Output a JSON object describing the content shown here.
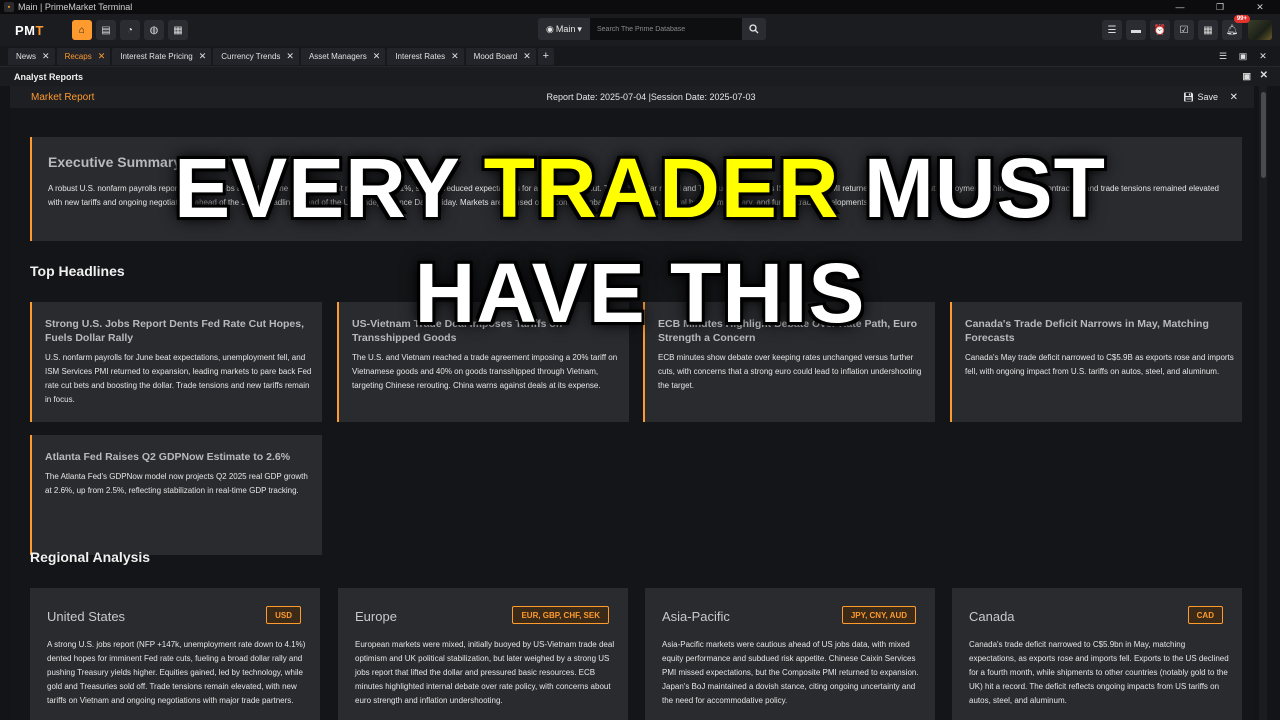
{
  "window": {
    "title": "Main | PrimeMarket Terminal",
    "controls": [
      "—",
      "❐",
      "✕"
    ]
  },
  "nav": {
    "logo_main": "PM",
    "logo_accent": "T",
    "workspace": "Main",
    "search_placeholder": "Search The Prime Database",
    "notification_badge": "99+"
  },
  "tabs": [
    {
      "label": "News",
      "active": false
    },
    {
      "label": "Recaps",
      "active": true
    },
    {
      "label": "Interest Rate Pricing",
      "active": false
    },
    {
      "label": "Currency Trends",
      "active": false
    },
    {
      "label": "Asset Managers",
      "active": false
    },
    {
      "label": "Interest Rates",
      "active": false
    },
    {
      "label": "Mood Board",
      "active": false
    }
  ],
  "panel": {
    "title": "Analyst Reports"
  },
  "report": {
    "title": "Market Report",
    "dates": "Report Date: 2025-07-04 |Session Date: 2025-07-03",
    "save_label": "Save"
  },
  "executive_summary": {
    "heading": "Executive Summary",
    "text": "A robust U.S. nonfarm payrolls report, with 147k jobs added and the unemployment rate falling to 4.1%, sharply reduced expectations for a July Fed rate cut. The U.S. dollar rallied and Treasuries sold off as ISM Services PMI returned to expansion, but employment within the sector contracted, and trade tensions remained elevated with new tariffs and ongoing negotiations ahead of the July 9 deadline ahead of the U.S. Independence Day holiday. Markets are focused on upcoming global economic data, central bank commentary, and further trade developments."
  },
  "top_headlines": {
    "heading": "Top Headlines",
    "items": [
      {
        "title": "Strong U.S. Jobs Report Dents Fed Rate Cut Hopes, Fuels Dollar Rally",
        "body": "U.S. nonfarm payrolls for June beat expectations, unemployment fell, and ISM Services PMI returned to expansion, leading markets to pare back Fed rate cut bets and boosting the dollar. Trade tensions and new tariffs remain in focus."
      },
      {
        "title": "US-Vietnam Trade Deal Imposes Tariffs on Transshipped Goods",
        "body": "The U.S. and Vietnam reached a trade agreement imposing a 20% tariff on Vietnamese goods and 40% on goods transshipped through Vietnam, targeting Chinese rerouting. China warns against deals at its expense."
      },
      {
        "title": "ECB Minutes Highlight Debate Over Rate Path, Euro Strength a Concern",
        "body": "ECB minutes show debate over keeping rates unchanged versus further cuts, with concerns that a strong euro could lead to inflation undershooting the target."
      },
      {
        "title": "Canada's Trade Deficit Narrows in May, Matching Forecasts",
        "body": "Canada's May trade deficit narrowed to C$5.9B as exports rose and imports fell, with ongoing impact from U.S. tariffs on autos, steel, and aluminum."
      },
      {
        "title": "Atlanta Fed Raises Q2 GDPNow Estimate to 2.6%",
        "body": "The Atlanta Fed's GDPNow model now projects Q2 2025 real GDP growth at 2.6%, up from 2.5%, reflecting stabilization in real-time GDP tracking."
      }
    ]
  },
  "regional_analysis": {
    "heading": "Regional Analysis",
    "items": [
      {
        "region": "United States",
        "currencies": "USD",
        "text": "A strong U.S. jobs report (NFP +147k, unemployment rate down to 4.1%) dented hopes for imminent Fed rate cuts, fueling a broad dollar rally and pushing Treasury yields higher. Equities gained, led by technology, while gold and Treasuries sold off. Trade tensions remain elevated, with new tariffs on Vietnam and ongoing negotiations with major trade partners."
      },
      {
        "region": "Europe",
        "currencies": "EUR, GBP, CHF, SEK",
        "text": "European markets were mixed, initially buoyed by US-Vietnam trade deal optimism and UK political stabilization, but later weighed by a strong US jobs report that lifted the dollar and pressured basic resources. ECB minutes highlighted internal debate over rate policy, with concerns about euro strength and inflation undershooting."
      },
      {
        "region": "Asia-Pacific",
        "currencies": "JPY, CNY, AUD",
        "text": "Asia-Pacific markets were cautious ahead of US jobs data, with mixed equity performance and subdued risk appetite. Chinese Caixin Services PMI missed expectations, but the Composite PMI returned to expansion. Japan's BoJ maintained a dovish stance, citing ongoing uncertainty and the need for accommodative policy."
      },
      {
        "region": "Canada",
        "currencies": "CAD",
        "text": "Canada's trade deficit narrowed to C$5.9bn in May, matching expectations, as exports rose and imports fell. Exports to the US declined for a fourth month, while shipments to other countries (notably gold to the UK) hit a record. The deficit reflects ongoing impacts from US tariffs on autos, steel, and aluminum."
      }
    ]
  },
  "overlay": {
    "line1_pre": "EVERY ",
    "line1_highlight": "TRADER",
    "line1_post": " MUST",
    "line2": "HAVE THIS"
  },
  "colors": {
    "accent": "#ff9a2e",
    "highlight": "#ffff00",
    "background": "#131417",
    "card": "#2a2b2f"
  }
}
